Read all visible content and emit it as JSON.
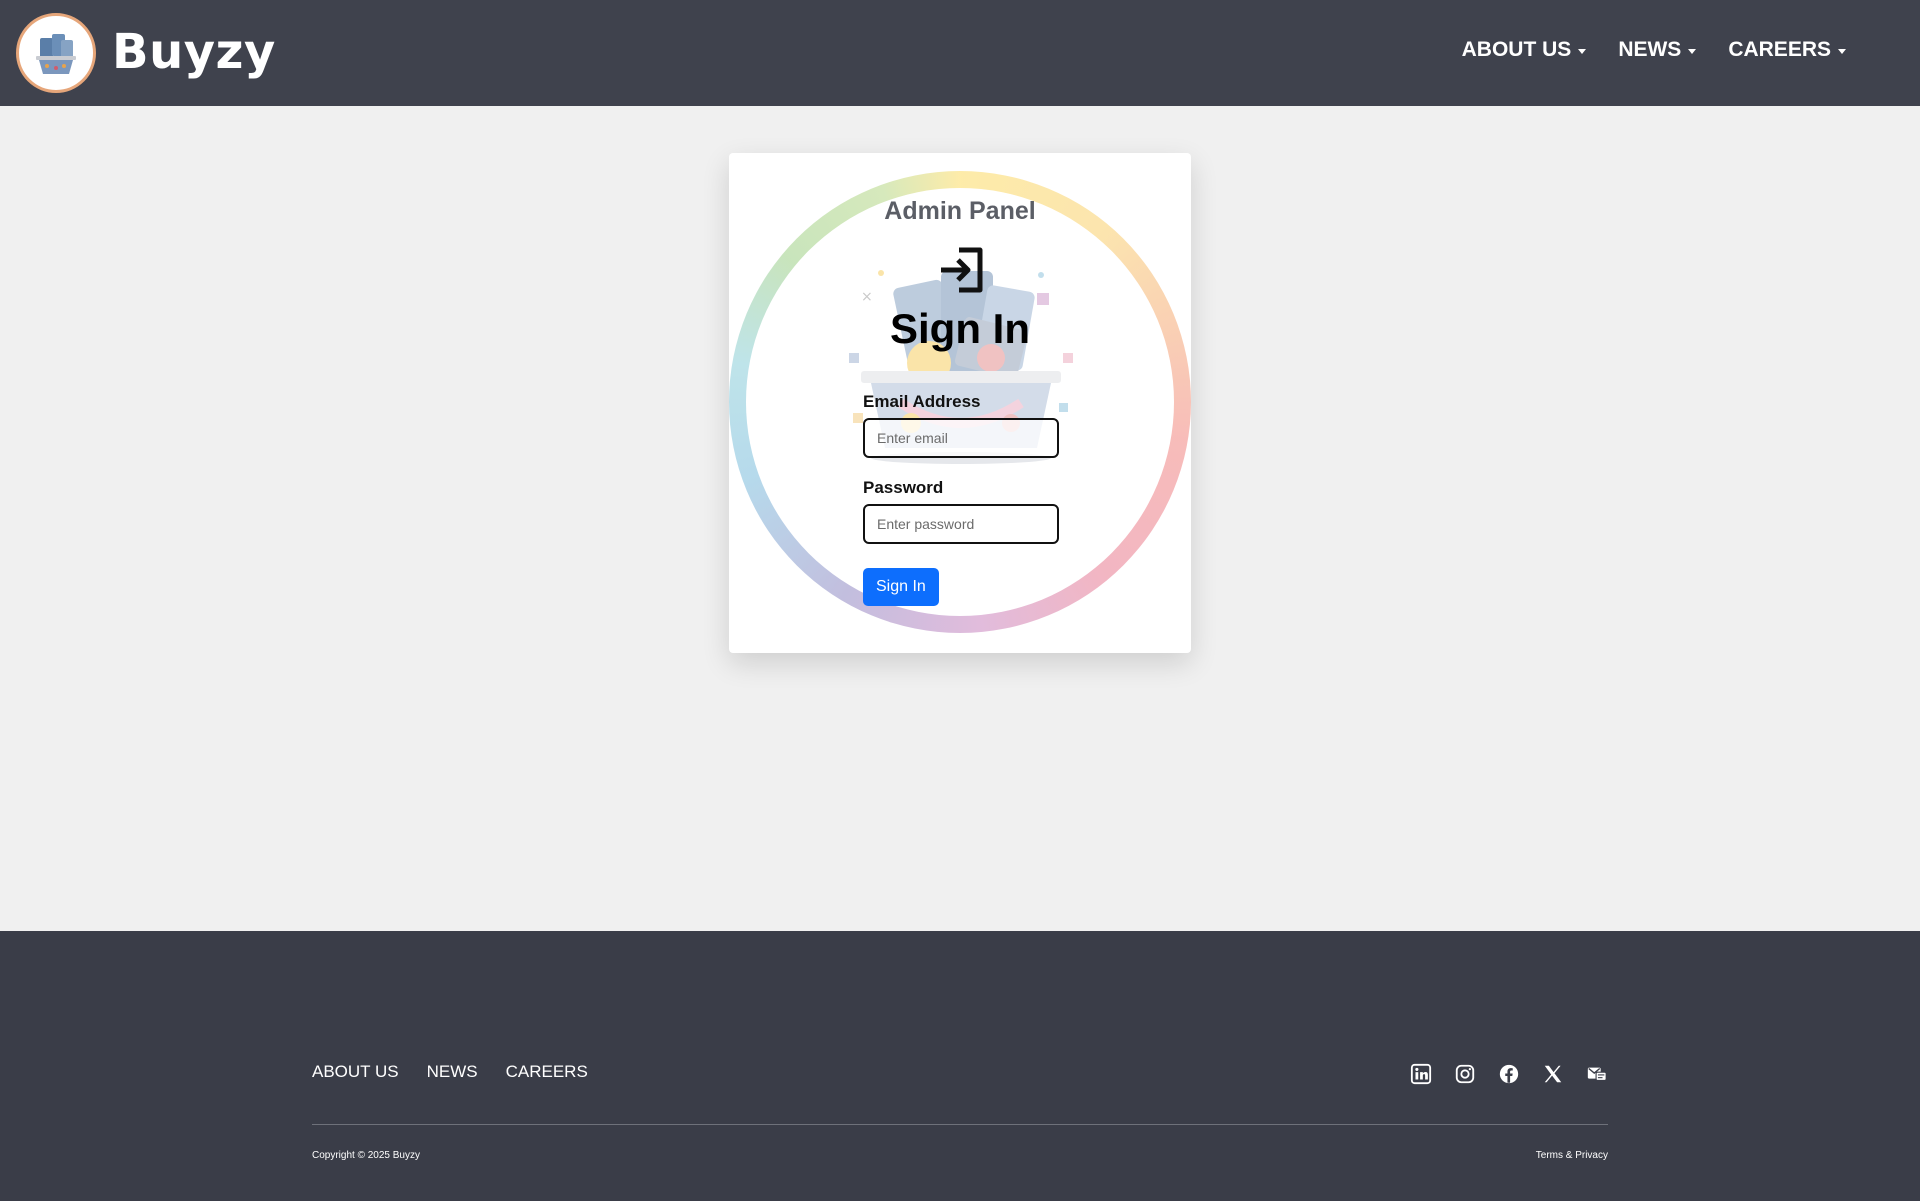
{
  "header": {
    "brand_name": "Buyzy",
    "nav": [
      {
        "label": "ABOUT US"
      },
      {
        "label": "NEWS"
      },
      {
        "label": "CAREERS"
      }
    ]
  },
  "login_card": {
    "panel_title": "Admin Panel",
    "heading": "Sign In",
    "email_label": "Email Address",
    "email_placeholder": "Enter email",
    "password_label": "Password",
    "password_placeholder": "Enter password",
    "submit_label": "Sign In"
  },
  "footer": {
    "links": [
      {
        "label": "ABOUT US"
      },
      {
        "label": "NEWS"
      },
      {
        "label": "CAREERS"
      }
    ],
    "social_icons": [
      "linkedin-icon",
      "instagram-icon",
      "facebook-icon",
      "x-icon",
      "email-icon"
    ],
    "copyright": "Copyright © 2025 Buyzy",
    "terms": "Terms & Privacy"
  },
  "colors": {
    "header_bg": "#3f424d",
    "footer_bg": "#3a3d48",
    "page_bg": "#f0f0f0",
    "primary_button": "#0d6efd"
  }
}
